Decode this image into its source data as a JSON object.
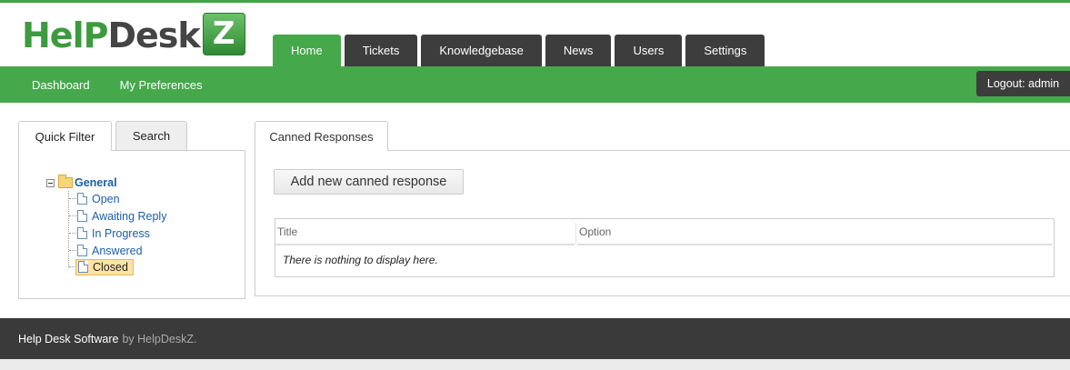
{
  "brand": {
    "logo_help": "HelP",
    "logo_desk": "Desk",
    "logo_z": "Z"
  },
  "main_tabs": [
    {
      "label": "Home",
      "active": true
    },
    {
      "label": "Tickets",
      "active": false
    },
    {
      "label": "Knowledgebase",
      "active": false
    },
    {
      "label": "News",
      "active": false
    },
    {
      "label": "Users",
      "active": false
    },
    {
      "label": "Settings",
      "active": false
    }
  ],
  "sub_nav": {
    "dashboard": "Dashboard",
    "preferences": "My Preferences",
    "logout": "Logout: admin"
  },
  "sidebar": {
    "tabs": {
      "quick_filter": "Quick Filter",
      "search": "Search"
    },
    "tree": {
      "root": "General",
      "items": [
        "Open",
        "Awaiting Reply",
        "In Progress",
        "Answered",
        "Closed"
      ],
      "selected": "Closed"
    }
  },
  "content": {
    "tab": "Canned Responses",
    "add_button": "Add new canned response",
    "columns": {
      "title": "Title",
      "option": "Option"
    },
    "empty_message": "There is nothing to display here."
  },
  "footer": {
    "strong": "Help Desk Software",
    "by": "by HelpDeskZ."
  },
  "colors": {
    "accent_green": "#45a84b",
    "dark": "#3d3d3d",
    "link_blue": "#1d5ea6",
    "selected_bg": "#fde3a7"
  }
}
